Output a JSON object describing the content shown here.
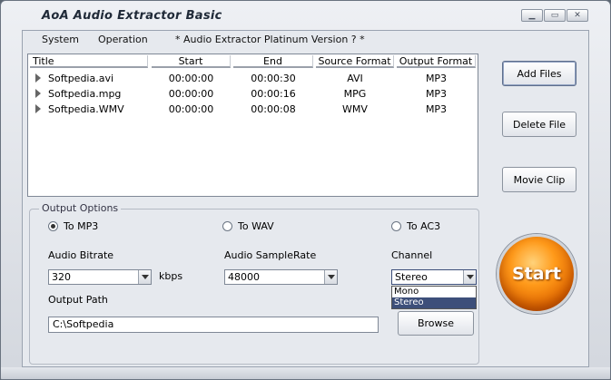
{
  "window": {
    "title": "AoA Audio Extractor Basic"
  },
  "menu": {
    "items": [
      "System",
      "Operation",
      "* Audio Extractor Platinum Version ? *"
    ]
  },
  "list": {
    "columns": [
      "Title",
      "Start",
      "End",
      "Source Format",
      "Output Format"
    ],
    "rows": [
      [
        "Softpedia.avi",
        "00:00:00",
        "00:00:30",
        "AVI",
        "MP3"
      ],
      [
        "Softpedia.mpg",
        "00:00:00",
        "00:00:16",
        "MPG",
        "MP3"
      ],
      [
        "Softpedia.WMV",
        "00:00:00",
        "00:00:08",
        "WMV",
        "MP3"
      ]
    ]
  },
  "side": {
    "add": "Add Files",
    "delete": "Delete File",
    "movie": "Movie Clip"
  },
  "options": {
    "label": "Output Options",
    "radios": [
      "To MP3",
      "To WAV",
      "To AC3"
    ],
    "selected": "To MP3",
    "bitrate_label": "Audio Bitrate",
    "bitrate": "320",
    "kbps": "kbps",
    "samplerate_label": "Audio SampleRate",
    "samplerate": "48000",
    "channel_label": "Channel",
    "channel": "Stereo",
    "channel_options": [
      "Mono",
      "Stereo"
    ],
    "path_label": "Output Path",
    "path": "C:\\Softpedia",
    "browse": "Browse"
  },
  "start": "Start"
}
